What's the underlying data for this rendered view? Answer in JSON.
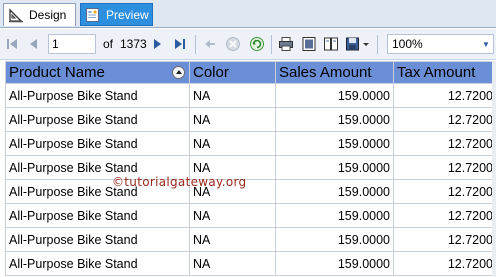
{
  "tabs": [
    {
      "label": "Design",
      "icon": "design-icon",
      "active": false
    },
    {
      "label": "Preview",
      "icon": "preview-icon",
      "active": true
    }
  ],
  "toolbar": {
    "current_page": "1",
    "of_label": "of",
    "total_pages": "1373",
    "zoom": "100%"
  },
  "table": {
    "headers": [
      "Product Name",
      "Color",
      "Sales Amount",
      "Tax Amount"
    ],
    "rows": [
      [
        "All-Purpose Bike Stand",
        "NA",
        "159.0000",
        "12.7200"
      ],
      [
        "All-Purpose Bike Stand",
        "NA",
        "159.0000",
        "12.7200"
      ],
      [
        "All-Purpose Bike Stand",
        "NA",
        "159.0000",
        "12.7200"
      ],
      [
        "All-Purpose Bike Stand",
        "NA",
        "159.0000",
        "12.7200"
      ],
      [
        "All-Purpose Bike Stand",
        "NA",
        "159.0000",
        "12.7200"
      ],
      [
        "All-Purpose Bike Stand",
        "NA",
        "159.0000",
        "12.7200"
      ],
      [
        "All-Purpose Bike Stand",
        "NA",
        "159.0000",
        "12.7200"
      ],
      [
        "All-Purpose Bike Stand",
        "NA",
        "159.0000",
        "12.7200"
      ]
    ]
  },
  "watermark": "©tutorialgateway.org",
  "colors": {
    "header_bg": "#6b8fd7",
    "active_tab": "#2d8fe0"
  }
}
